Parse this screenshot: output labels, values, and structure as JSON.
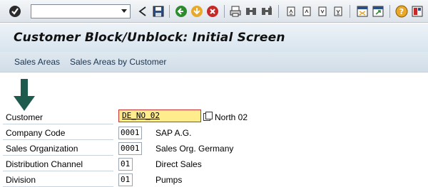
{
  "toolbar": {
    "command_value": "",
    "icons": [
      "enter-icon",
      "dropdown-arrow-icon",
      "collapse-icon",
      "save-icon",
      "back-icon",
      "exit-icon",
      "cancel-icon",
      "print-icon",
      "find-icon",
      "find-next-icon",
      "first-page-icon",
      "previous-page-icon",
      "next-page-icon",
      "last-page-icon",
      "create-session-icon",
      "shortcut-icon",
      "help-icon",
      "layout-menu-icon"
    ]
  },
  "title": "Customer Block/Unblock: Initial Screen",
  "app_toolbar": {
    "sales_areas": "Sales Areas",
    "sales_areas_by_customer": "Sales Areas by Customer"
  },
  "form": {
    "customer": {
      "label": "Customer",
      "value": "DE_NO_02",
      "description": "North 02"
    },
    "company_code": {
      "label": "Company Code",
      "value": "0001",
      "description": "SAP A.G."
    },
    "sales_org": {
      "label": "Sales Organization",
      "value": "0001",
      "description": "Sales Org. Germany"
    },
    "distribution_channel": {
      "label": "Distribution Channel",
      "value": "01",
      "description": "Direct Sales"
    },
    "division": {
      "label": "Division",
      "value": "01",
      "description": "Pumps"
    }
  },
  "colors": {
    "active_field_bg": "#ffec8c",
    "arrow": "#1e5a4e"
  }
}
